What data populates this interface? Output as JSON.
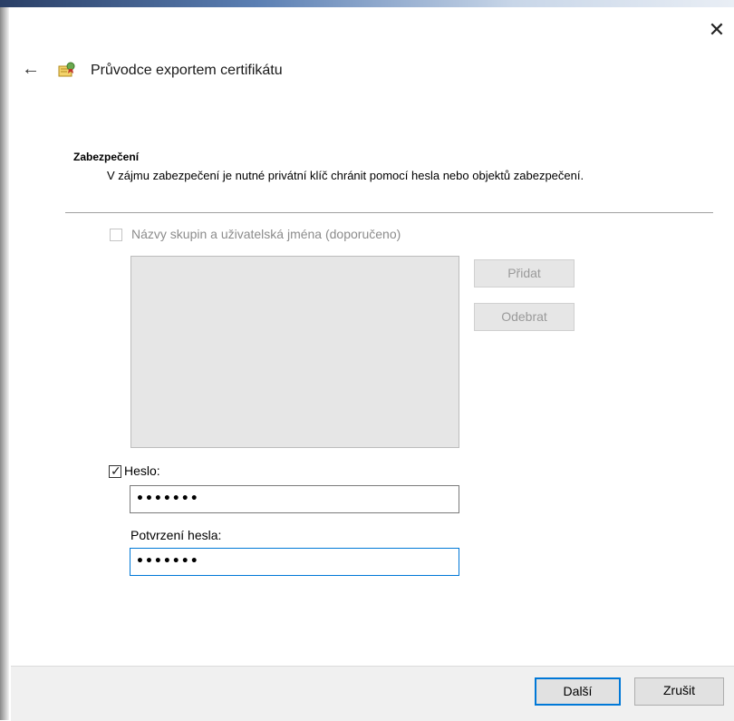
{
  "window": {
    "title": "Průvodce exportem certifikátu",
    "close_glyph": "✕",
    "back_glyph": "←",
    "icon": "certificate-wizard-icon"
  },
  "security": {
    "heading": "Zabezpečení",
    "description": "V zájmu zabezpečení je nutné privátní klíč chránit pomocí hesla nebo objektů zabezpečení.",
    "groups_checkbox": {
      "label": "Názvy skupin a uživatelská jména (doporučeno)",
      "checked": false,
      "disabled": true
    },
    "add_label": "Přidat",
    "remove_label": "Odebrat",
    "password_checkbox": {
      "label": "Heslo:",
      "checked": true
    },
    "password_value": "•••••••",
    "confirm_label": "Potvrzení hesla:",
    "confirm_value": "•••••••"
  },
  "footer": {
    "next_label": "Další",
    "cancel_label": "Zrušit"
  },
  "colors": {
    "accent": "#0078d7",
    "footer_bg": "#f0f0f0",
    "disabled_text": "#8c8c8c"
  }
}
